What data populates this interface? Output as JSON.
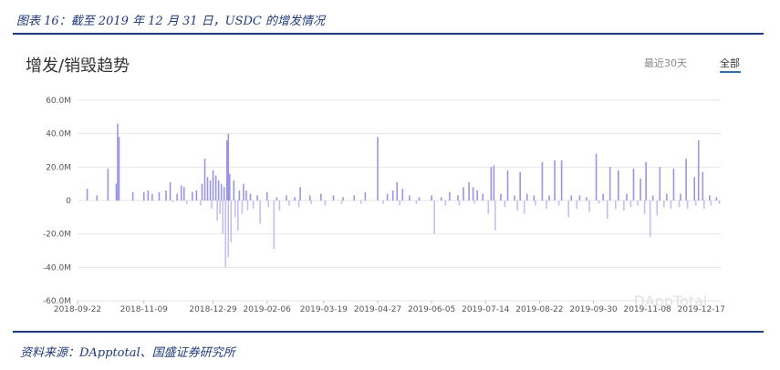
{
  "figure": {
    "caption": "图表 16：截至 2019 年 12 月 31 日，USDC 的增发情况",
    "source": "资料来源：DApptotal、国盛证券研究所"
  },
  "panel": {
    "title": "增发/销毁趋势",
    "tabs": [
      {
        "label": "最近30天",
        "active": false
      },
      {
        "label": "全部",
        "active": true
      }
    ],
    "watermark": "DAppTotal"
  },
  "colors": {
    "mint_bar": "#9c95e6",
    "burn_bar": "#c4bff1",
    "grid": "#e6e6e6",
    "accent": "#1f3a7a",
    "tab_underline": "#2f6fb4"
  },
  "chart_data": {
    "type": "bar",
    "title": "增发/销毁趋势",
    "xlabel": "",
    "ylabel": "",
    "ylim": [
      -60,
      60
    ],
    "y_unit": "M",
    "y_tick_labels": [
      "60.0M",
      "40.0M",
      "20.0M",
      "0",
      "-20.0M",
      "-40.0M",
      "-60.0M"
    ],
    "y_ticks": [
      60,
      40,
      20,
      0,
      -20,
      -40,
      -60
    ],
    "x_tick_labels": [
      "2018-09-22",
      "2018-11-09",
      "2018-12-29",
      "2019-02-06",
      "2019-03-19",
      "2019-04-27",
      "2019-06-05",
      "2019-07-14",
      "2019-08-22",
      "2019-09-30",
      "2019-11-08",
      "2019-12-17"
    ],
    "x_range": [
      "2018-09-22",
      "2019-12-31"
    ],
    "grid": true,
    "series": [
      {
        "name": "增发",
        "values": [
          [
            "2018-09-29",
            7
          ],
          [
            "2018-10-06",
            3
          ],
          [
            "2018-10-14",
            19
          ],
          [
            "2018-10-20",
            10
          ],
          [
            "2018-10-21",
            46
          ],
          [
            "2018-10-22",
            38
          ],
          [
            "2018-11-01",
            5
          ],
          [
            "2018-11-09",
            5
          ],
          [
            "2018-11-12",
            6
          ],
          [
            "2018-11-15",
            4
          ],
          [
            "2018-11-20",
            5
          ],
          [
            "2018-11-25",
            6
          ],
          [
            "2018-11-28",
            11
          ],
          [
            "2018-12-03",
            4
          ],
          [
            "2018-12-06",
            9
          ],
          [
            "2018-12-08",
            8
          ],
          [
            "2018-12-14",
            5
          ],
          [
            "2018-12-17",
            6
          ],
          [
            "2018-12-21",
            10
          ],
          [
            "2018-12-23",
            25
          ],
          [
            "2018-12-25",
            14
          ],
          [
            "2018-12-27",
            12
          ],
          [
            "2018-12-29",
            18
          ],
          [
            "2018-12-31",
            15
          ],
          [
            "2019-01-02",
            12
          ],
          [
            "2019-01-04",
            10
          ],
          [
            "2019-01-06",
            8
          ],
          [
            "2019-01-08",
            36
          ],
          [
            "2019-01-09",
            40
          ],
          [
            "2019-01-10",
            16
          ],
          [
            "2019-01-13",
            12
          ],
          [
            "2019-01-17",
            6
          ],
          [
            "2019-01-20",
            10
          ],
          [
            "2019-01-22",
            6
          ],
          [
            "2019-01-25",
            4
          ],
          [
            "2019-01-30",
            3
          ],
          [
            "2019-02-06",
            5
          ],
          [
            "2019-02-13",
            2
          ],
          [
            "2019-02-20",
            3
          ],
          [
            "2019-02-26",
            2
          ],
          [
            "2019-03-02",
            8
          ],
          [
            "2019-03-09",
            3
          ],
          [
            "2019-03-17",
            4
          ],
          [
            "2019-03-26",
            3
          ],
          [
            "2019-04-02",
            2
          ],
          [
            "2019-04-10",
            3
          ],
          [
            "2019-04-18",
            5
          ],
          [
            "2019-04-27",
            38
          ],
          [
            "2019-05-04",
            4
          ],
          [
            "2019-05-08",
            6
          ],
          [
            "2019-05-11",
            11
          ],
          [
            "2019-05-15",
            7
          ],
          [
            "2019-05-20",
            3
          ],
          [
            "2019-05-27",
            2
          ],
          [
            "2019-06-05",
            3
          ],
          [
            "2019-06-12",
            2
          ],
          [
            "2019-06-18",
            5
          ],
          [
            "2019-06-24",
            3
          ],
          [
            "2019-06-28",
            8
          ],
          [
            "2019-07-02",
            11
          ],
          [
            "2019-07-05",
            8
          ],
          [
            "2019-07-08",
            6
          ],
          [
            "2019-07-12",
            4
          ],
          [
            "2019-07-18",
            20
          ],
          [
            "2019-07-20",
            21
          ],
          [
            "2019-07-25",
            4
          ],
          [
            "2019-07-30",
            18
          ],
          [
            "2019-08-04",
            3
          ],
          [
            "2019-08-08",
            17
          ],
          [
            "2019-08-13",
            4
          ],
          [
            "2019-08-18",
            3
          ],
          [
            "2019-08-24",
            23
          ],
          [
            "2019-08-29",
            3
          ],
          [
            "2019-09-02",
            24
          ],
          [
            "2019-09-07",
            24
          ],
          [
            "2019-09-14",
            3
          ],
          [
            "2019-09-20",
            3
          ],
          [
            "2019-09-25",
            2
          ],
          [
            "2019-10-02",
            28
          ],
          [
            "2019-10-07",
            4
          ],
          [
            "2019-10-12",
            20
          ],
          [
            "2019-10-18",
            18
          ],
          [
            "2019-10-24",
            4
          ],
          [
            "2019-10-29",
            19
          ],
          [
            "2019-11-03",
            13
          ],
          [
            "2019-11-07",
            23
          ],
          [
            "2019-11-12",
            3
          ],
          [
            "2019-11-17",
            20
          ],
          [
            "2019-11-22",
            4
          ],
          [
            "2019-11-27",
            19
          ],
          [
            "2019-12-02",
            4
          ],
          [
            "2019-12-06",
            25
          ],
          [
            "2019-12-12",
            14
          ],
          [
            "2019-12-15",
            36
          ],
          [
            "2019-12-18",
            17
          ],
          [
            "2019-12-23",
            3
          ],
          [
            "2019-12-28",
            2
          ]
        ]
      },
      {
        "name": "销毁",
        "values": [
          [
            "2018-11-30",
            -1
          ],
          [
            "2018-12-10",
            -2
          ],
          [
            "2018-12-20",
            -3
          ],
          [
            "2018-12-28",
            -5
          ],
          [
            "2019-01-01",
            -12
          ],
          [
            "2019-01-03",
            -8
          ],
          [
            "2019-01-05",
            -20
          ],
          [
            "2019-01-07",
            -40
          ],
          [
            "2019-01-09",
            -34
          ],
          [
            "2019-01-11",
            -25
          ],
          [
            "2019-01-14",
            -10
          ],
          [
            "2019-01-16",
            -18
          ],
          [
            "2019-01-19",
            -8
          ],
          [
            "2019-01-23",
            -6
          ],
          [
            "2019-01-27",
            -5
          ],
          [
            "2019-02-01",
            -14
          ],
          [
            "2019-02-07",
            -4
          ],
          [
            "2019-02-11",
            -29
          ],
          [
            "2019-02-15",
            -6
          ],
          [
            "2019-02-22",
            -3
          ],
          [
            "2019-03-01",
            -4
          ],
          [
            "2019-03-10",
            -2
          ],
          [
            "2019-03-20",
            -3
          ],
          [
            "2019-04-01",
            -2
          ],
          [
            "2019-04-15",
            -2
          ],
          [
            "2019-05-01",
            -2
          ],
          [
            "2019-05-13",
            -3
          ],
          [
            "2019-05-25",
            -2
          ],
          [
            "2019-06-07",
            -20
          ],
          [
            "2019-06-15",
            -3
          ],
          [
            "2019-06-25",
            -3
          ],
          [
            "2019-07-06",
            -2
          ],
          [
            "2019-07-16",
            -8
          ],
          [
            "2019-07-21",
            -18
          ],
          [
            "2019-07-28",
            -4
          ],
          [
            "2019-08-06",
            -6
          ],
          [
            "2019-08-11",
            -8
          ],
          [
            "2019-08-19",
            -3
          ],
          [
            "2019-08-27",
            -5
          ],
          [
            "2019-09-05",
            -3
          ],
          [
            "2019-09-12",
            -10
          ],
          [
            "2019-09-18",
            -5
          ],
          [
            "2019-09-27",
            -7
          ],
          [
            "2019-10-04",
            -2
          ],
          [
            "2019-10-10",
            -11
          ],
          [
            "2019-10-16",
            -5
          ],
          [
            "2019-10-22",
            -6
          ],
          [
            "2019-10-27",
            -4
          ],
          [
            "2019-11-01",
            -3
          ],
          [
            "2019-11-06",
            -8
          ],
          [
            "2019-11-10",
            -22
          ],
          [
            "2019-11-15",
            -9
          ],
          [
            "2019-11-20",
            -4
          ],
          [
            "2019-11-25",
            -5
          ],
          [
            "2019-12-01",
            -4
          ],
          [
            "2019-12-07",
            -5
          ],
          [
            "2019-12-13",
            -3
          ],
          [
            "2019-12-19",
            -5
          ],
          [
            "2019-12-24",
            -3
          ],
          [
            "2019-12-30",
            -2
          ]
        ]
      }
    ]
  }
}
